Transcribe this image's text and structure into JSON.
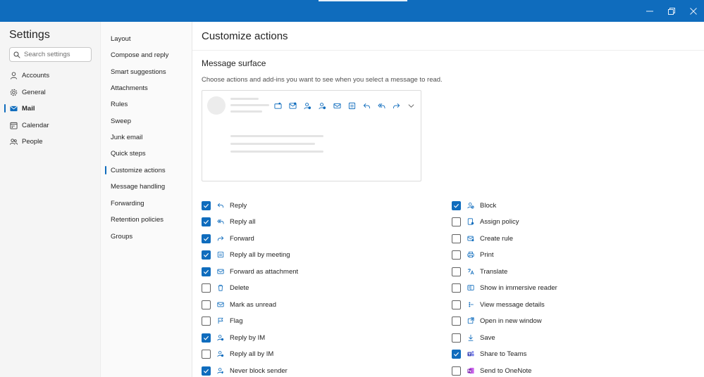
{
  "window": {
    "controls": [
      {
        "name": "minimize",
        "icon": "minimize-icon"
      },
      {
        "name": "restore",
        "icon": "restore-icon"
      },
      {
        "name": "close",
        "icon": "close-icon"
      }
    ],
    "accent": "#0f6cbd"
  },
  "sidebar": {
    "title": "Settings",
    "search_placeholder": "Search settings",
    "categories": [
      {
        "label": "Accounts",
        "icon": "person-icon"
      },
      {
        "label": "General",
        "icon": "gear-icon"
      },
      {
        "label": "Mail",
        "icon": "mail-icon",
        "selected": true
      },
      {
        "label": "Calendar",
        "icon": "calendar-icon"
      },
      {
        "label": "People",
        "icon": "people-icon"
      }
    ]
  },
  "subnav": {
    "items": [
      {
        "label": "Layout"
      },
      {
        "label": "Compose and reply"
      },
      {
        "label": "Smart suggestions"
      },
      {
        "label": "Attachments"
      },
      {
        "label": "Rules"
      },
      {
        "label": "Sweep"
      },
      {
        "label": "Junk email"
      },
      {
        "label": "Quick steps"
      },
      {
        "label": "Customize actions",
        "selected": true
      },
      {
        "label": "Message handling"
      },
      {
        "label": "Forwarding"
      },
      {
        "label": "Retention policies"
      },
      {
        "label": "Groups"
      }
    ]
  },
  "main": {
    "title": "Customize actions",
    "section_title": "Message surface",
    "section_desc": "Choose actions and add-ins you want to see when you select a message to read.",
    "preview_icons": [
      "share-to-teams-icon",
      "forward-as-attachment-icon",
      "reply-by-im-icon",
      "reply-by-im-icon",
      "mail-icon",
      "meeting-icon",
      "reply-icon",
      "reply-all-icon",
      "forward-icon",
      "chevron-down-icon"
    ],
    "actions_left": [
      {
        "label": "Reply",
        "checked": true,
        "icon": "reply-icon"
      },
      {
        "label": "Reply all",
        "checked": true,
        "icon": "reply-all-icon"
      },
      {
        "label": "Forward",
        "checked": true,
        "icon": "forward-icon"
      },
      {
        "label": "Reply all by meeting",
        "checked": true,
        "icon": "meeting-icon"
      },
      {
        "label": "Forward as attachment",
        "checked": true,
        "icon": "attachment-mail-icon"
      },
      {
        "label": "Delete",
        "checked": false,
        "icon": "trash-icon"
      },
      {
        "label": "Mark as unread",
        "checked": false,
        "icon": "envelope-icon"
      },
      {
        "label": "Flag",
        "checked": false,
        "icon": "flag-icon"
      },
      {
        "label": "Reply by IM",
        "checked": true,
        "icon": "chat-person-icon"
      },
      {
        "label": "Reply all by IM",
        "checked": false,
        "icon": "chat-person-icon"
      },
      {
        "label": "Never block sender",
        "checked": true,
        "icon": "shield-person-icon"
      }
    ],
    "actions_right": [
      {
        "label": "Block",
        "checked": true,
        "icon": "block-person-icon"
      },
      {
        "label": "Assign policy",
        "checked": false,
        "icon": "policy-icon"
      },
      {
        "label": "Create rule",
        "checked": false,
        "icon": "rule-icon"
      },
      {
        "label": "Print",
        "checked": false,
        "icon": "printer-icon"
      },
      {
        "label": "Translate",
        "checked": false,
        "icon": "translate-icon"
      },
      {
        "label": "Show in immersive reader",
        "checked": false,
        "icon": "immersive-reader-icon"
      },
      {
        "label": "View message details",
        "checked": false,
        "icon": "details-icon"
      },
      {
        "label": "Open in new window",
        "checked": false,
        "icon": "open-window-icon"
      },
      {
        "label": "Save",
        "checked": false,
        "icon": "download-icon"
      },
      {
        "label": "Share to Teams",
        "checked": true,
        "icon": "teams-icon"
      },
      {
        "label": "Send to OneNote",
        "checked": false,
        "icon": "onenote-icon"
      }
    ]
  }
}
